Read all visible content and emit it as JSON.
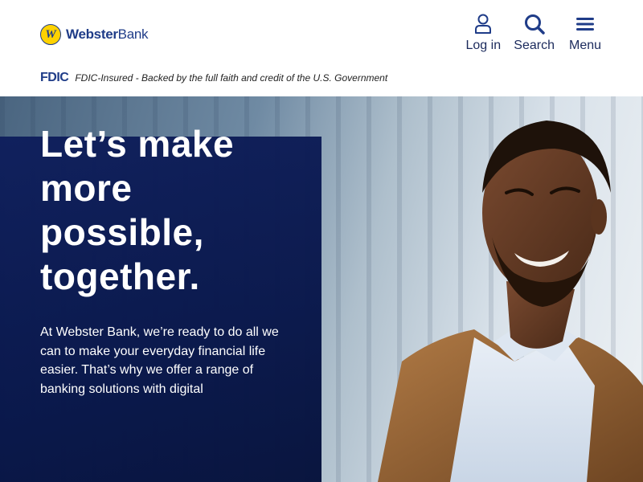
{
  "header": {
    "logo": {
      "mark": "W",
      "brand_bold": "Webster",
      "brand_light": "Bank"
    },
    "nav": {
      "login_label": "Log in",
      "search_label": "Search",
      "menu_label": "Menu"
    },
    "fdic": {
      "logo_text": "FDIC",
      "notice": "FDIC-Insured - Backed by the full faith and credit of the U.S. Government"
    }
  },
  "hero": {
    "title": "Let’s make more possible, together.",
    "body": "At Webster Bank, we’re ready to do all we can to make your everyday financial life easier. That’s why we offer a range of banking solutions with digital"
  },
  "colors": {
    "brand_navy": "#1f3c88",
    "brand_yellow": "#ffd200",
    "nav_text": "#1b2a5c",
    "hero_panel": "#0e1e5c"
  },
  "icons": {
    "login": "user-icon",
    "search": "search-icon",
    "menu": "hamburger-icon"
  }
}
